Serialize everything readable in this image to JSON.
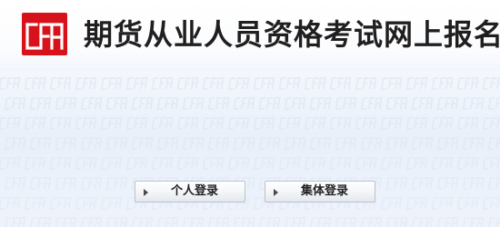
{
  "header": {
    "logo_text": "CFA",
    "title": "期货从业人员资格考试网上报名"
  },
  "login": {
    "personal_label": "个人登录",
    "group_label": "集体登录"
  },
  "colors": {
    "brand_red": "#d7121b",
    "pattern_blue": "#d9e3f0",
    "title_text": "#1f1f1f"
  }
}
